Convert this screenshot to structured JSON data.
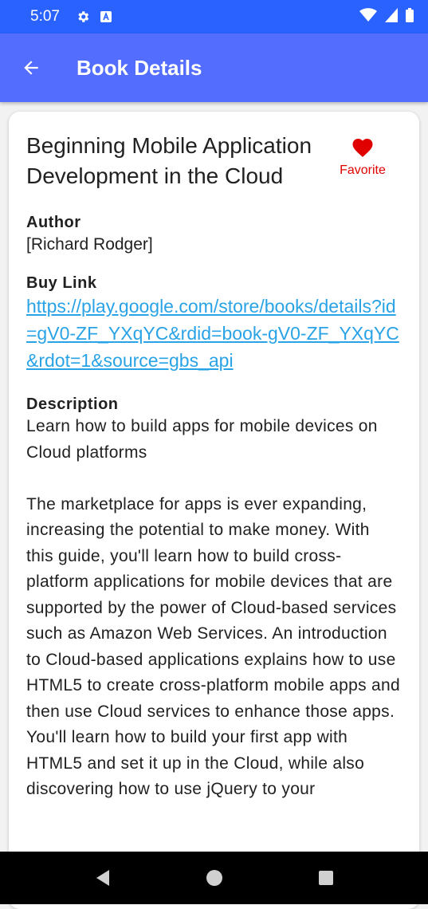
{
  "status_bar": {
    "time": "5:07",
    "icons": [
      "settings-icon",
      "a-icon",
      "wifi-icon",
      "signal-icon",
      "battery-icon"
    ]
  },
  "app_bar": {
    "title": "Book Details",
    "back_icon": "arrow-back-icon",
    "background": "#536dfe"
  },
  "book": {
    "title": "Beginning Mobile Application Development in the Cloud",
    "favorite_label": "Favorite",
    "favorite_color": "#e00000",
    "author_label": "Author",
    "author_value": "[Richard Rodger]",
    "buy_link_label": "Buy Link",
    "buy_link_value": "https://play.google.com/store/books/details?id=gV0-ZF_YXqYC&rdid=book-gV0-ZF_YXqYC&rdot=1&source=gbs_api",
    "description_label": "Description",
    "description_text": "Learn how to build apps for mobile devices on Cloud platforms\n\nThe marketplace for apps is ever expanding, increasing the potential to make money. With this guide, you'll learn how to build cross-platform applications for mobile devices that are supported by the power of Cloud-based services such as Amazon Web Services. An introduction to Cloud-based applications explains how to use HTML5 to create cross-platform mobile apps and then use Cloud services to enhance those apps. You'll learn how to build your first app with HTML5 and set it up in the Cloud, while also discovering how to use jQuery to your"
  },
  "nav_bar": {
    "icons": [
      "back-triangle-icon",
      "home-circle-icon",
      "recents-square-icon"
    ]
  }
}
